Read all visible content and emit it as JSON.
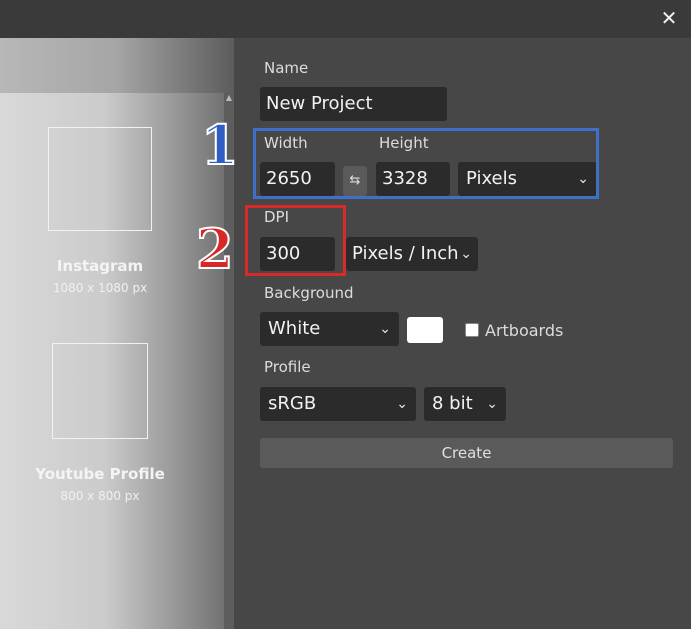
{
  "dialog": {
    "close_symbol": "✕"
  },
  "presets": [
    {
      "name": "Instagram",
      "size": "1080 x 1080 px"
    },
    {
      "name": "Youtube Profile",
      "size": "800 x 800 px"
    }
  ],
  "form": {
    "name_label": "Name",
    "name_value": "New Project",
    "width_label": "Width",
    "width_value": "2650",
    "height_label": "Height",
    "height_value": "3328",
    "swap_symbol": "⇆",
    "unit_value": "Pixels",
    "dpi_label": "DPI",
    "dpi_value": "300",
    "dpi_unit_value": "Pixels / Inch",
    "background_label": "Background",
    "background_value": "White",
    "background_color": "#ffffff",
    "artboards_label": "Artboards",
    "artboards_checked": false,
    "profile_label": "Profile",
    "profile_value": "sRGB",
    "bit_value": "8 bit",
    "create_label": "Create"
  },
  "annotations": {
    "marker_1": "1",
    "marker_1_color": "#3e70c9",
    "marker_2": "2",
    "marker_2_color": "#d92a2a"
  }
}
